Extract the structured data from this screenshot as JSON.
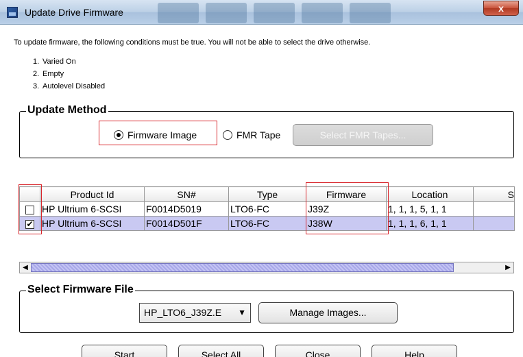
{
  "window": {
    "title": "Update Drive Firmware",
    "close_glyph": "x"
  },
  "intro": "To update firmware, the following conditions must be true. You will not be able to select the drive otherwise.",
  "conditions": [
    {
      "num": "1.",
      "text": "Varied On"
    },
    {
      "num": "2.",
      "text": "Empty"
    },
    {
      "num": "3.",
      "text": "Autolevel Disabled"
    }
  ],
  "update_method": {
    "legend": "Update Method",
    "option_firmware_image": "Firmware Image",
    "option_fmr_tape": "FMR Tape",
    "selected": "Firmware Image",
    "select_fmr_button": "Select FMR Tapes..."
  },
  "table": {
    "headers": [
      "Product Id",
      "SN#",
      "Type",
      "Firmware",
      "Location",
      "S"
    ],
    "rows": [
      {
        "checked": false,
        "product": "HP Ultrium 6-SCSI",
        "sn": "F0014D5019",
        "type": "LTO6-FC",
        "firmware": "J39Z",
        "location": "1, 1, 1, 5, 1, 1"
      },
      {
        "checked": true,
        "product": "HP Ultrium 6-SCSI",
        "sn": "F0014D501F",
        "type": "LTO6-FC",
        "firmware": "J38W",
        "location": "1, 1, 1, 6, 1, 1"
      }
    ]
  },
  "firmware_file": {
    "legend": "Select Firmware File",
    "selected_file": "HP_LTO6_J39Z.E",
    "manage_button": "Manage Images..."
  },
  "buttons": {
    "start": "Start",
    "select_all": "Select All",
    "close": "Close",
    "help": "Help"
  },
  "colors": {
    "highlight": "#d9262c",
    "selected_row": "#c9c9f2"
  }
}
